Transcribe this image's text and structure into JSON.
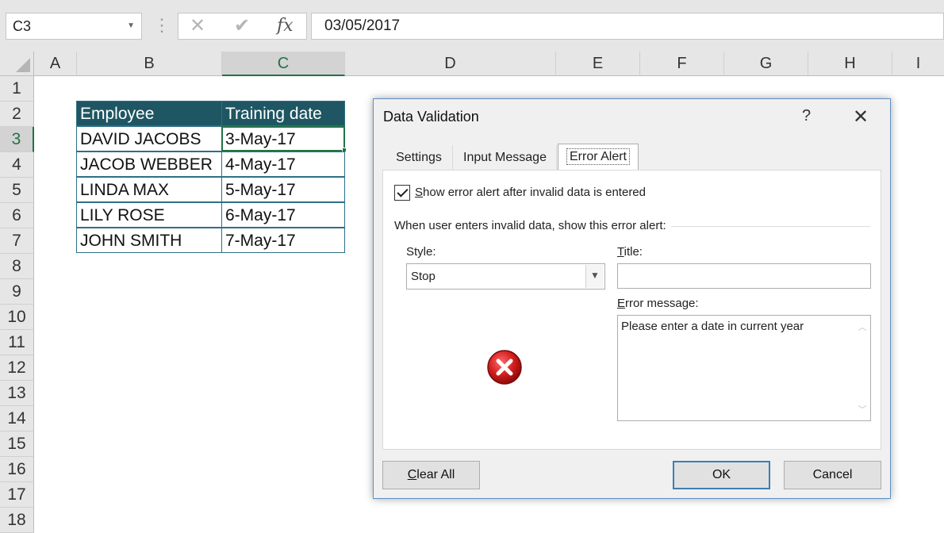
{
  "formula_bar": {
    "name_box": "C3",
    "cancel_glyph": "✕",
    "enter_glyph": "✔",
    "fx_label": "fx",
    "formula": "03/05/2017"
  },
  "columns": [
    "A",
    "B",
    "C",
    "D",
    "E",
    "F",
    "G",
    "H",
    "I"
  ],
  "selected_column": "C",
  "rows": [
    "1",
    "2",
    "3",
    "4",
    "5",
    "6",
    "7",
    "8",
    "9",
    "10",
    "11",
    "12",
    "13",
    "14",
    "15",
    "16",
    "17",
    "18"
  ],
  "selected_row": "3",
  "table": {
    "headers": [
      "Employee",
      "Training date"
    ],
    "rows": [
      [
        "DAVID JACOBS",
        "3-May-17"
      ],
      [
        "JACOB WEBBER",
        "4-May-17"
      ],
      [
        "LINDA MAX",
        "5-May-17"
      ],
      [
        "LILY ROSE",
        "6-May-17"
      ],
      [
        "JOHN SMITH",
        "7-May-17"
      ]
    ]
  },
  "dialog": {
    "title": "Data Validation",
    "help": "?",
    "close": "✕",
    "tabs": [
      "Settings",
      "Input Message",
      "Error Alert"
    ],
    "active_tab": "Error Alert",
    "show_alert_checked": true,
    "show_alert_label_first": "S",
    "show_alert_label_rest": "how error alert after invalid data is entered",
    "group_label": "When user enters invalid data, show this error alert:",
    "style_label": "Style:",
    "style_value": "Stop",
    "title_label_first": "T",
    "title_label_rest": "itle:",
    "title_value": "",
    "error_message_label_first": "E",
    "error_message_label_rest": "rror message:",
    "error_message_value": "Please enter a date in current year",
    "clear_all_first": "C",
    "clear_all_rest": "lear All",
    "ok_label": "OK",
    "cancel_label": "Cancel",
    "icon": "stop-error-icon"
  },
  "colors": {
    "table_header_bg": "#1f5663",
    "excel_green": "#217346",
    "error_red": "#c8102e"
  }
}
